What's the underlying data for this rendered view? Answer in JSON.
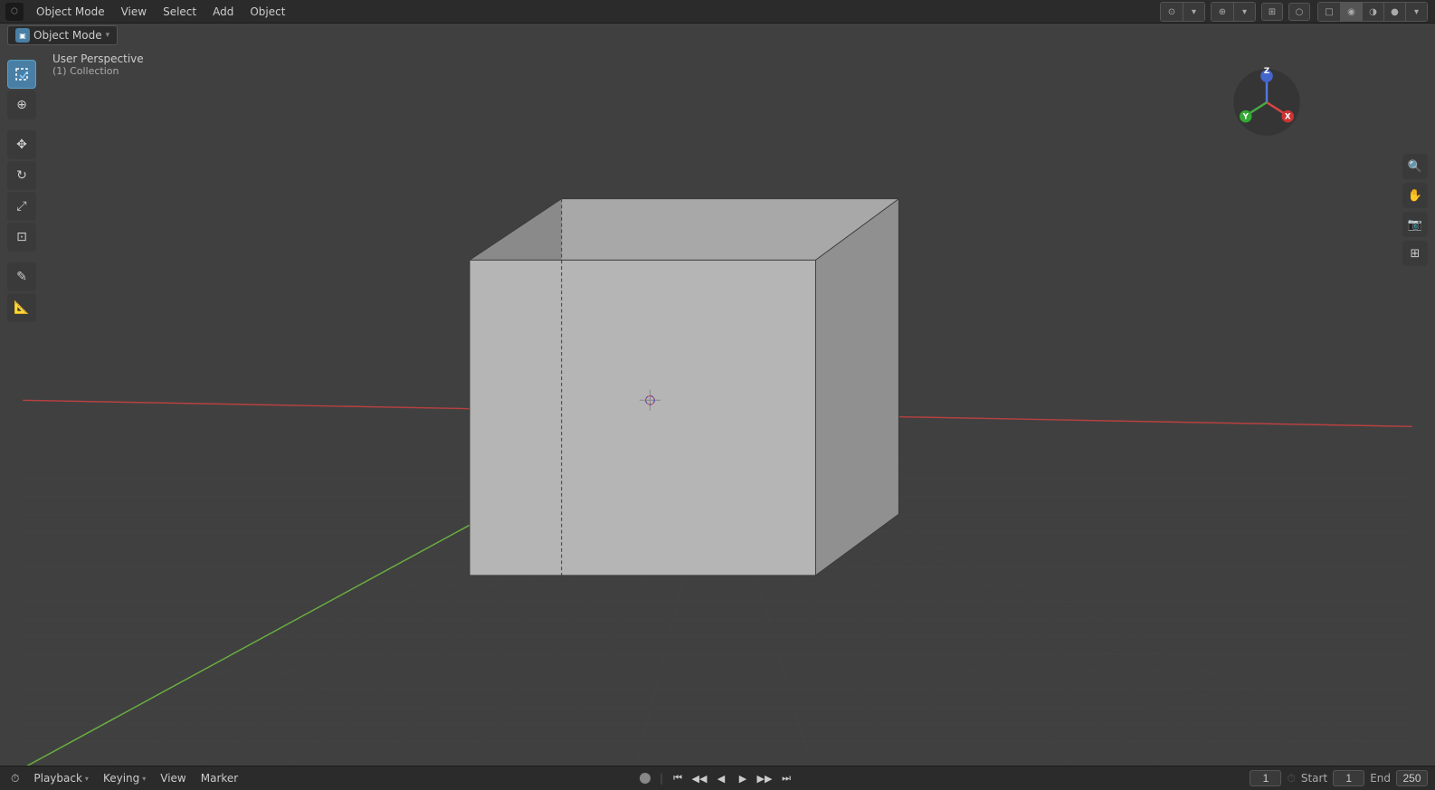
{
  "topbar": {
    "engine_label": "⬡",
    "menu_items": [
      "Object Mode",
      "View",
      "Select",
      "Add",
      "Object"
    ]
  },
  "topbar_right": {
    "icons": [
      {
        "name": "viewport-shading-icon",
        "label": "👁"
      },
      {
        "name": "overlay-icon",
        "label": "⊙"
      },
      {
        "name": "gizmo-icon",
        "label": "⊕"
      },
      {
        "name": "snap-icon",
        "label": "⊞"
      },
      {
        "name": "proportional-icon",
        "label": "○"
      },
      {
        "name": "square-icon",
        "label": "▣"
      },
      {
        "name": "sphere-icon",
        "label": "◉"
      },
      {
        "name": "material-icon",
        "label": "◑"
      },
      {
        "name": "render-icon",
        "label": "●"
      },
      {
        "name": "dropdown-icon",
        "label": "▾"
      }
    ]
  },
  "viewport": {
    "mode": "Object Mode",
    "view_title": "User Perspective",
    "collection": "(1) Collection"
  },
  "tools": {
    "left": [
      {
        "name": "select-tool",
        "icon": "⊹",
        "active": true
      },
      {
        "name": "cursor-tool",
        "icon": "⊕"
      },
      {
        "name": "move-tool",
        "icon": "✥"
      },
      {
        "name": "rotate-tool",
        "icon": "↻"
      },
      {
        "name": "scale-tool",
        "icon": "⤢"
      },
      {
        "name": "transform-tool",
        "icon": "⊞"
      },
      {
        "name": "annotate-tool",
        "icon": "✎"
      },
      {
        "name": "measure-tool",
        "icon": "📐"
      }
    ],
    "right": [
      {
        "name": "zoom-tool",
        "icon": "🔍"
      },
      {
        "name": "pan-tool",
        "icon": "✋"
      },
      {
        "name": "camera-tool",
        "icon": "📷"
      },
      {
        "name": "perspective-toggle",
        "icon": "⊞"
      }
    ]
  },
  "gizmo": {
    "x_color": "#cc3333",
    "y_color": "#33cc33",
    "z_color": "#3333cc",
    "x_label": "X",
    "y_label": "Y",
    "z_label": "Z"
  },
  "bottombar": {
    "playback_label": "Playback",
    "keying_label": "Keying",
    "view_label": "View",
    "marker_label": "Marker",
    "frame_current": "1",
    "frame_start": "1",
    "frame_end": "250",
    "start_label": "Start",
    "end_label": "End"
  },
  "playback": {
    "buttons": [
      {
        "name": "jump-start-btn",
        "icon": "⏮"
      },
      {
        "name": "prev-keyframe-btn",
        "icon": "◀◀"
      },
      {
        "name": "prev-frame-btn",
        "icon": "◀"
      },
      {
        "name": "play-btn",
        "icon": "▶"
      },
      {
        "name": "next-frame-btn",
        "icon": "▶▶"
      },
      {
        "name": "jump-end-btn",
        "icon": "⏭"
      }
    ]
  }
}
